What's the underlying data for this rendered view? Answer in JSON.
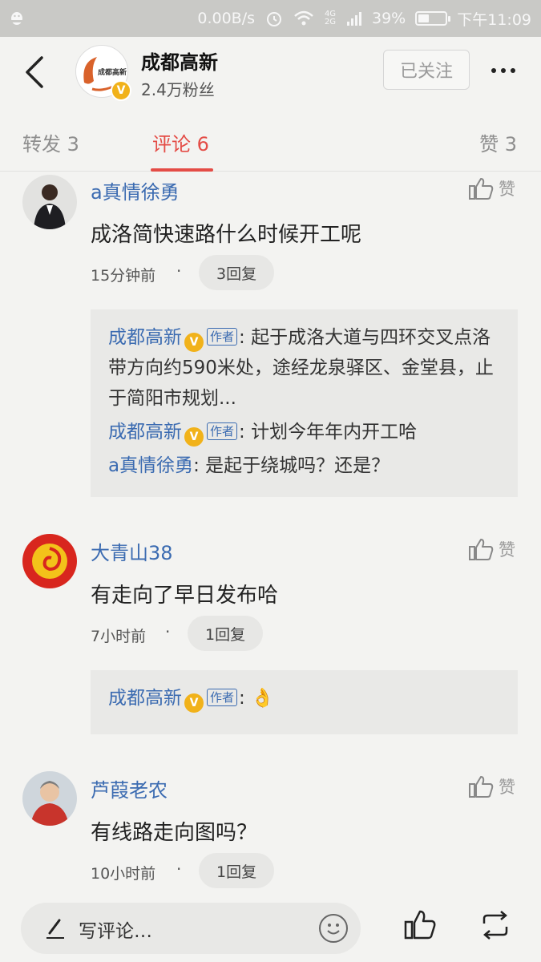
{
  "status_bar": {
    "net_speed": "0.00B/s",
    "network": "4G 2G",
    "battery": "39%",
    "battery_level": 0.39,
    "time": "下午11:09"
  },
  "header": {
    "account_name": "成都高新",
    "fans": "2.4万粉丝",
    "follow_label": "已关注",
    "verified_mark": "V",
    "logo_text": "成都高新"
  },
  "tabs": {
    "repost": "转发 3",
    "comment": "评论 6",
    "like": "赞 3"
  },
  "like_label": "赞",
  "author_tag": "作者",
  "comments": [
    {
      "user": "a真情徐勇",
      "text": "成洛简快速路什么时候开工呢",
      "time": "15分钟前",
      "replies": "3回复",
      "sub_replies": [
        {
          "user": "成都高新",
          "text": ": 起于成洛大道与四环交叉点洛带方向约590米处，途经龙泉驿区、金堂县，止于简阳市规划..."
        },
        {
          "user": "成都高新",
          "text": ": 计划今年年内开工哈"
        },
        {
          "user": "a真情徐勇",
          "text": ": 是起于绕城吗？还是？"
        }
      ]
    },
    {
      "user": "大青山38",
      "text": "有走向了早日发布哈",
      "time": "7小时前",
      "replies": "1回复",
      "sub_replies": [
        {
          "user": "成都高新",
          "text": ": 👌"
        }
      ]
    },
    {
      "user": "芦葭老农",
      "text": "有线路走向图吗？",
      "time": "10小时前",
      "replies": "1回复"
    }
  ],
  "bottom_bar": {
    "placeholder": "写评论…"
  },
  "colors": {
    "accent": "#e44c46",
    "link": "#3b6bb1",
    "verified": "#f1b21a"
  }
}
